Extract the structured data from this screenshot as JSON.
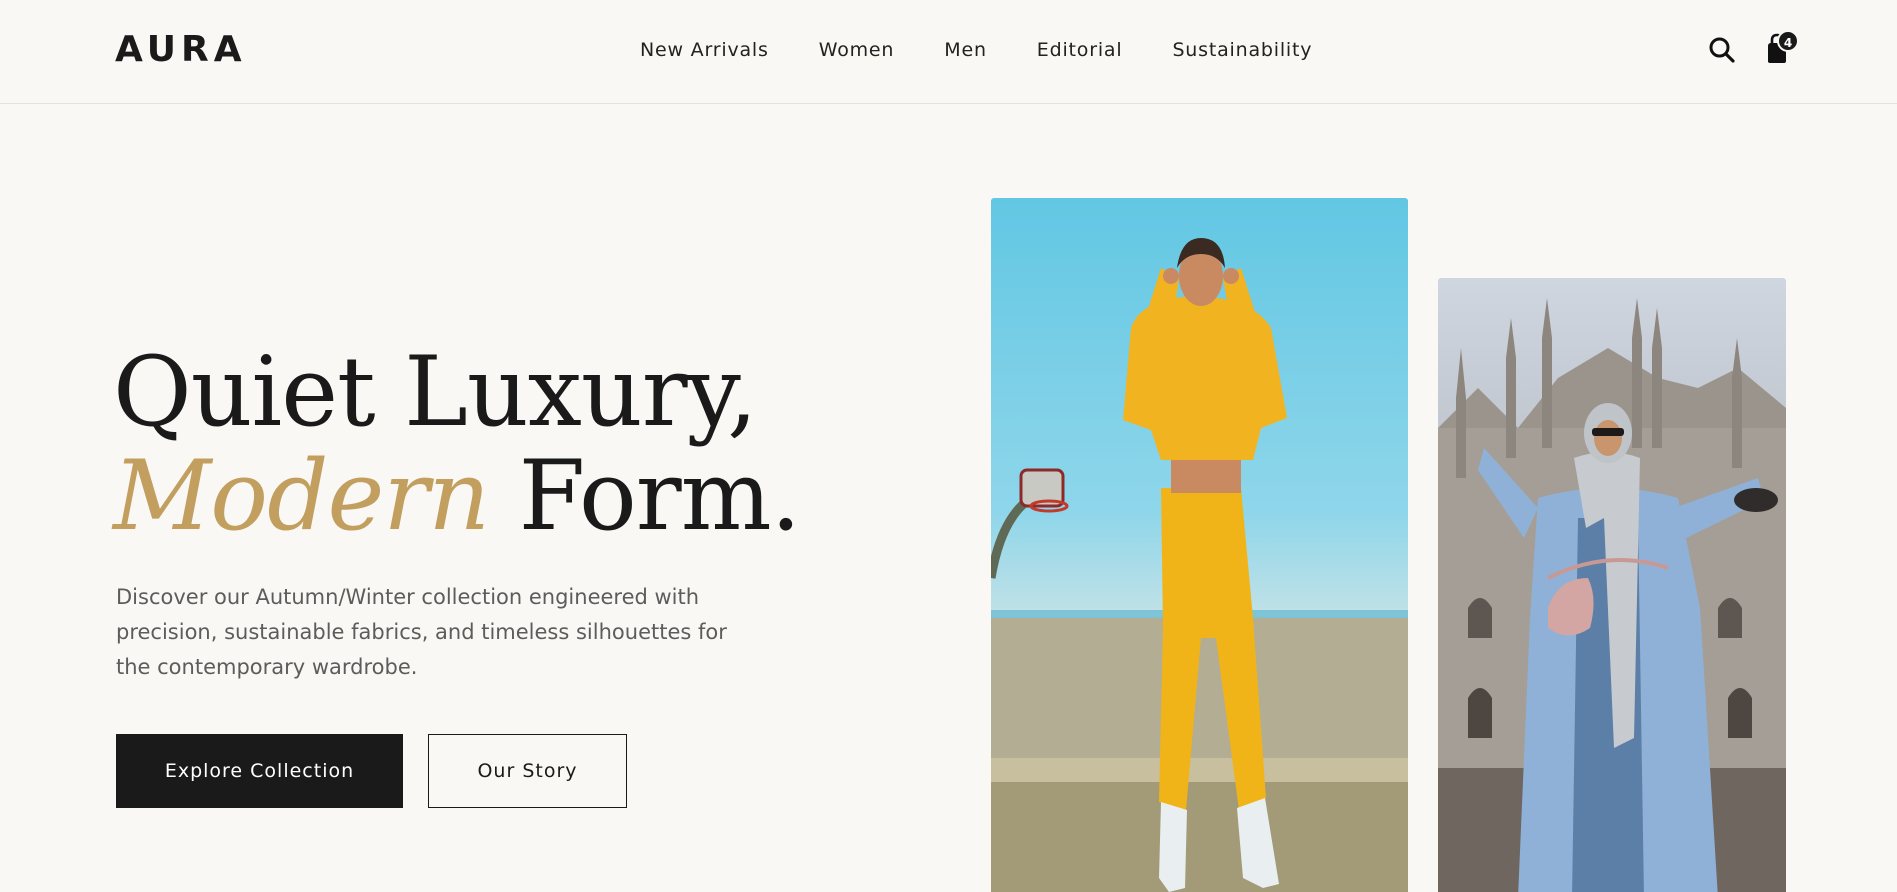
{
  "brand": {
    "logo": "AURA"
  },
  "nav": {
    "items": [
      "New Arrivals",
      "Women",
      "Men",
      "Editorial",
      "Sustainability"
    ]
  },
  "header_actions": {
    "search_icon": "search-icon",
    "cart_icon": "shopping-bag-icon",
    "cart_count": "4"
  },
  "hero": {
    "title_line1": "Quiet Luxury,",
    "title_accent": "Modern",
    "title_line2_rest": " Form.",
    "description": "Discover our Autumn/Winter collection engineered with precision, sustainable fabrics, and timeless silhouettes for the contemporary wardrobe.",
    "primary_cta": "Explore Collection",
    "secondary_cta": "Our Story"
  },
  "colors": {
    "background": "#f9f8f5",
    "text": "#1a1a1a",
    "accent": "#c29f5f",
    "muted": "#5c5c5c"
  }
}
